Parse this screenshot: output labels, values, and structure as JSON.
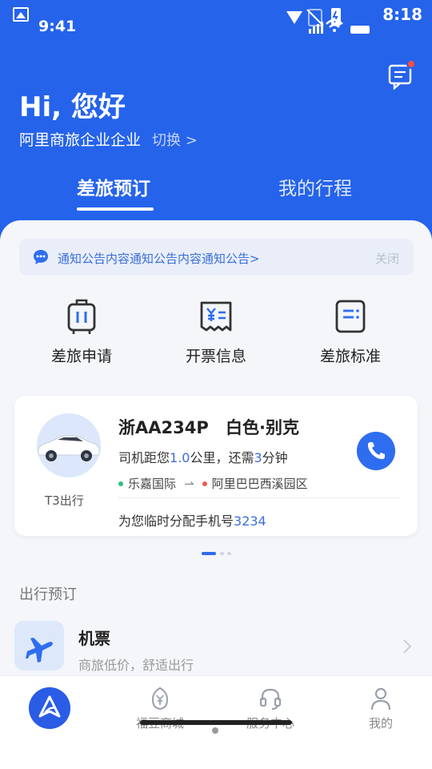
{
  "status_bar": {
    "time_left": "9:41",
    "time_right": "8:18"
  },
  "header": {
    "greeting": "Hi, 您好",
    "company": "阿里商旅企业企业",
    "switch_label": "切换 >",
    "tabs": [
      {
        "label": "差旅预订",
        "active": true
      },
      {
        "label": "我的行程",
        "active": false
      }
    ]
  },
  "notice": {
    "text": "通知公告内容通知公告内容通知公告>",
    "close_label": "关闭"
  },
  "quick_actions": [
    {
      "label": "差旅申请",
      "icon": "luggage-icon"
    },
    {
      "label": "开票信息",
      "icon": "invoice-icon"
    },
    {
      "label": "差旅标准",
      "icon": "document-icon"
    }
  ],
  "trip_card": {
    "provider": "T3出行",
    "plate": "浙AA234P",
    "car_desc": "白色·别克",
    "driver_prefix": "司机距您",
    "distance": "1.0",
    "driver_mid": "公里，还需",
    "minutes": "3",
    "driver_suffix": "分钟",
    "from": "乐嘉国际",
    "arrow": "⇀",
    "to": "阿里巴巴西溪园区",
    "phone_prefix": "为您临时分配手机号",
    "phone_number": "3234"
  },
  "section": {
    "title": "出行预订"
  },
  "flight": {
    "title": "机票",
    "subtitle": "商旅低价，舒适出行"
  },
  "bottom_nav": [
    {
      "label": "福豆商城",
      "icon": "mall-icon"
    },
    {
      "label": "服务中心",
      "icon": "headset-icon"
    },
    {
      "label": "我的",
      "icon": "user-icon"
    }
  ],
  "colors": {
    "brand": "#2563EB",
    "accent": "#3B6FD8",
    "badge": "#FF4D3D"
  }
}
